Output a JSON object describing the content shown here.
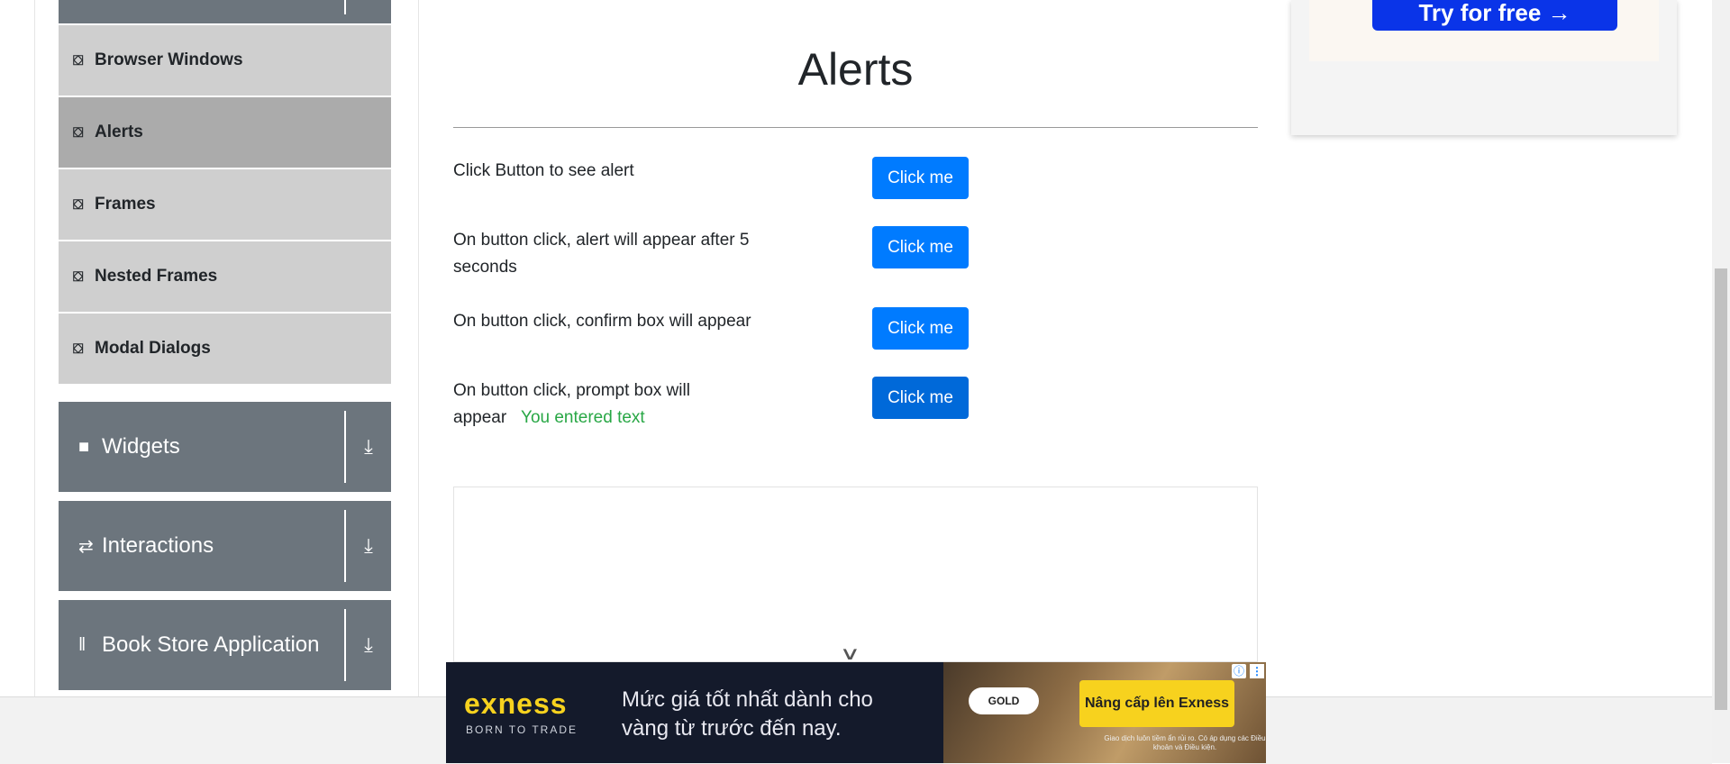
{
  "sidebar": {
    "sub_items": [
      {
        "label": "Browser Windows",
        "icon": "html5-icon"
      },
      {
        "label": "Alerts",
        "icon": "html5-icon",
        "active": true
      },
      {
        "label": "Frames",
        "icon": "html5-icon"
      },
      {
        "label": "Nested Frames",
        "icon": "html5-icon"
      },
      {
        "label": "Modal Dialogs",
        "icon": "html5-icon"
      }
    ],
    "groups": [
      {
        "label": "Widgets",
        "icon": "widgets-icon"
      },
      {
        "label": "Interactions",
        "icon": "interactions-icon"
      },
      {
        "label": "Book Store Application",
        "icon": "book-store-icon"
      }
    ]
  },
  "main": {
    "title": "Alerts",
    "rows": [
      {
        "text": "Click Button to see alert",
        "button": "Click me"
      },
      {
        "text": "On button click, alert will appear after 5 seconds",
        "button": "Click me"
      },
      {
        "text": "On button click, confirm box will appear",
        "button": "Click me"
      },
      {
        "text": "On button click, prompt box will appear",
        "result": "You entered text",
        "button": "Click me"
      }
    ]
  },
  "right_ad": {
    "button_label": "Try for free →"
  },
  "banner": {
    "brand": "exness",
    "tagline": "BORN TO TRADE",
    "message": "Mức giá tốt nhất dành cho vàng từ trước đến nay.",
    "gold_badge": "GOLD",
    "cta": "Nâng cấp lên Exness",
    "disclaimer": "Giao dịch luôn tiềm ẩn rủi ro. Có áp dụng các Điều khoản và Điều kiện."
  },
  "colors": {
    "primary": "#007bff",
    "sidebar_group": "#6c757d",
    "sidebar_item": "#cfcfcf",
    "sidebar_active": "#ababab",
    "success": "#28a745"
  }
}
